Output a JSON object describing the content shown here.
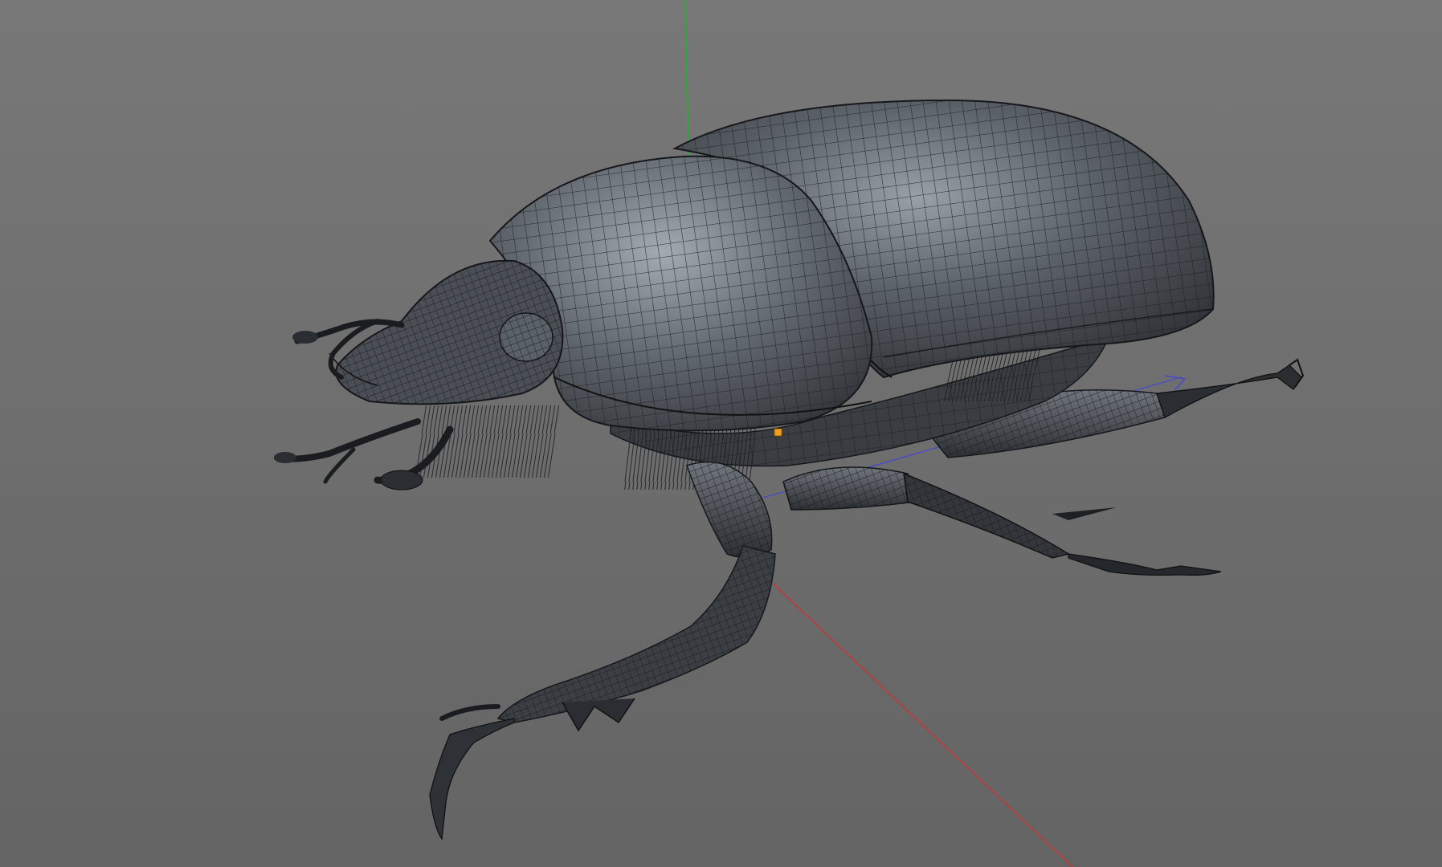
{
  "viewport": {
    "background_top": "#757575",
    "background_bottom": "#666666",
    "mesh_fill": "#3f4449",
    "mesh_light": "#8a9098",
    "mesh_wire": "#1a1c1f",
    "hair": "#1e2022"
  },
  "axes": {
    "x_color": "#c03a3a",
    "y_color": "#2fa83a",
    "z_color": "#4a4ac8"
  },
  "pivot": {
    "color": "#f0a020"
  },
  "model": {
    "icon": "beetle-wireframe"
  }
}
